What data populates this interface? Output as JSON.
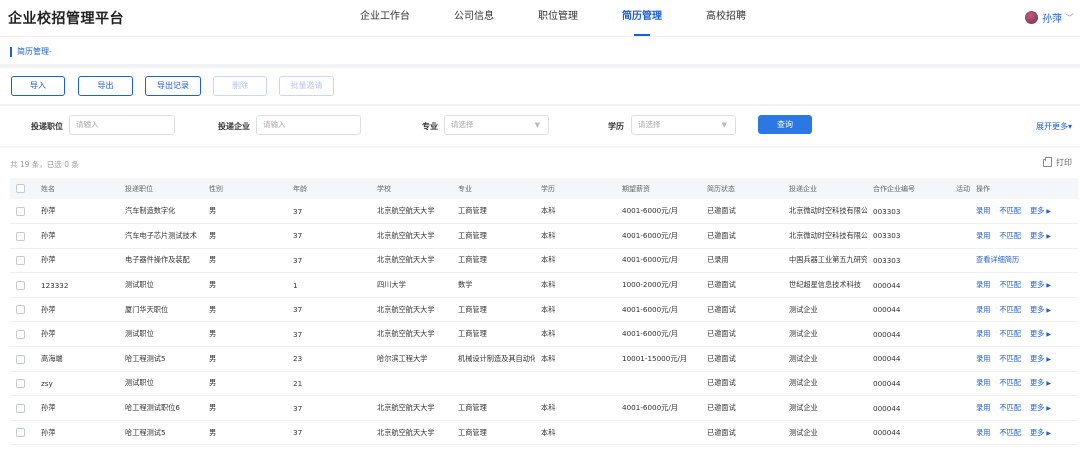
{
  "app": {
    "title": "企业校招管理平台"
  },
  "nav": [
    {
      "label": "企业工作台",
      "active": false
    },
    {
      "label": "公司信息",
      "active": false
    },
    {
      "label": "职位管理",
      "active": false
    },
    {
      "label": "简历管理",
      "active": true
    },
    {
      "label": "高校招聘",
      "active": false
    }
  ],
  "user": {
    "name": "孙萍",
    "caret": "﹀"
  },
  "breadcrumb": "简历管理-",
  "toolbar": {
    "import": "导入",
    "export": "导出",
    "export_log": "导出记录",
    "delete": "删除",
    "batch_invite": "批量邀请"
  },
  "filters": {
    "position_label": "投递职位",
    "position_placeholder": "请输入",
    "company_label": "投递企业",
    "company_placeholder": "请输入",
    "major_label": "专业",
    "major_placeholder": "请选择",
    "edu_label": "学历",
    "edu_placeholder": "请选择",
    "query": "查询",
    "expand": "展开更多▾"
  },
  "summary": "共 19 条，已选 0 条",
  "print": "打印",
  "table": {
    "columns": [
      "姓名",
      "投递职位",
      "性别",
      "年龄",
      "学校",
      "专业",
      "学历",
      "期望薪资",
      "简历状态",
      "投递企业",
      "合作企业编号",
      "活动",
      "操作"
    ],
    "rows": [
      [
        "孙萍",
        "汽车制造数字化",
        "男",
        "37",
        "北京航空航天大学",
        "工商管理",
        "本科",
        "4001-6000元/月",
        "已邀面试",
        "北京微动时空科技有限公司",
        "003303",
        "",
        "ops"
      ],
      [
        "孙萍",
        "汽车电子芯片测试技术",
        "男",
        "37",
        "北京航空航天大学",
        "工商管理",
        "本科",
        "4001-6000元/月",
        "已邀面试",
        "北京微动时空科技有限公司",
        "003303",
        "",
        "ops"
      ],
      [
        "孙萍",
        "电子器件操作及装配",
        "男",
        "37",
        "北京航空航天大学",
        "工商管理",
        "本科",
        "4001-6000元/月",
        "已录用",
        "中国兵器工业第五九研究所",
        "003303",
        "",
        "detail"
      ],
      [
        "123332",
        "测试职位",
        "男",
        "1",
        "四川大学",
        "数学",
        "本科",
        "1000-2000元/月",
        "已邀面试",
        "世纪超星信息技术科技",
        "000044",
        "",
        "ops"
      ],
      [
        "孙萍",
        "厦门华天职位",
        "男",
        "37",
        "北京航空航天大学",
        "工商管理",
        "本科",
        "4001-6000元/月",
        "已邀面试",
        "测试企业",
        "000044",
        "",
        "ops"
      ],
      [
        "孙萍",
        "测试职位",
        "男",
        "37",
        "北京航空航天大学",
        "工商管理",
        "本科",
        "4001-6000元/月",
        "已邀面试",
        "测试企业",
        "000044",
        "",
        "ops"
      ],
      [
        "高海端",
        "哈工程测试5",
        "男",
        "23",
        "哈尔滨工程大学",
        "机械设计制造及其自动化",
        "本科",
        "10001-15000元/月",
        "已邀面试",
        "测试企业",
        "000044",
        "",
        "ops"
      ],
      [
        "zsy",
        "测试职位",
        "男",
        "21",
        "",
        "",
        "",
        "",
        "已邀面试",
        "测试企业",
        "000044",
        "",
        "ops"
      ],
      [
        "孙萍",
        "哈工程测试职位6",
        "男",
        "37",
        "北京航空航天大学",
        "工商管理",
        "本科",
        "4001-6000元/月",
        "已邀面试",
        "测试企业",
        "000044",
        "",
        "ops"
      ],
      [
        "孙萍",
        "哈工程测试5",
        "男",
        "37",
        "北京航空航天大学",
        "工商管理",
        "本科",
        "",
        "已邀面试",
        "测试企业",
        "000044",
        "",
        "ops"
      ]
    ],
    "ops": {
      "hire": "录用",
      "mismatch": "不匹配",
      "more": "更多",
      "detail": "查看详细简历"
    }
  },
  "colors": {
    "accent": "#1f5fd6",
    "query_button": "#2b78e4",
    "header_bg": "#f4f6fa"
  }
}
